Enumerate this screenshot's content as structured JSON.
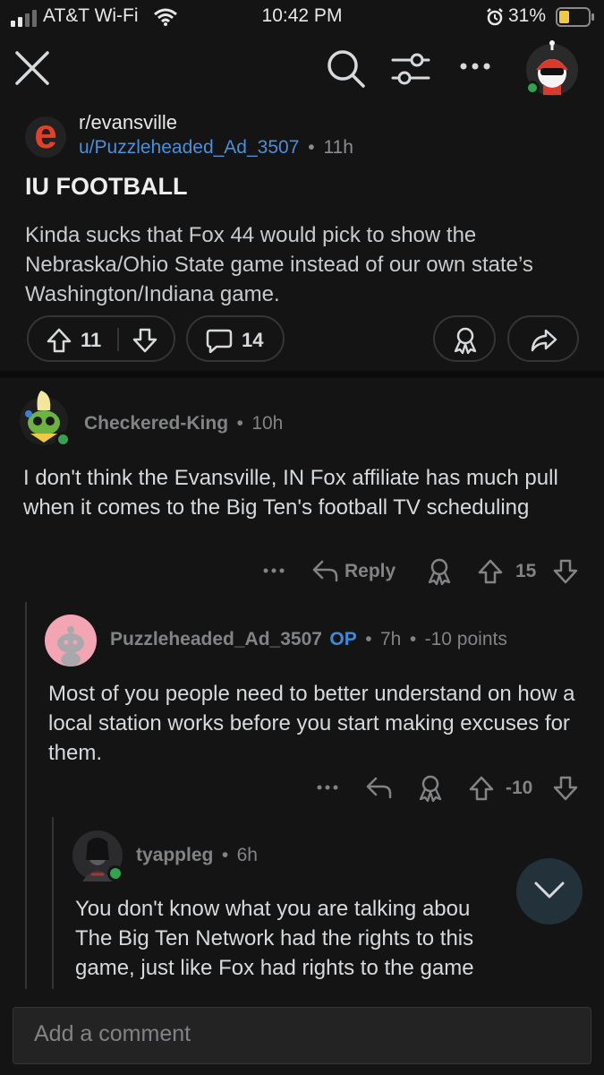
{
  "status_bar": {
    "carrier": "AT&T Wi-Fi",
    "time": "10:42 PM",
    "battery": "31%"
  },
  "nav": {
    "close_icon": "close-icon",
    "search_icon": "search-icon",
    "filter_icon": "sliders-icon",
    "more_icon": "more-icon"
  },
  "post": {
    "subreddit": "r/evansville",
    "author": "u/Puzzleheaded_Ad_3507",
    "separator": "•",
    "age": "11h",
    "title": "IU FOOTBALL",
    "body": "Kinda sucks that Fox 44 would pick to show the Nebraska/Ohio State game instead of our own state’s Washington/Indiana game.",
    "upvotes": "11",
    "comments": "14",
    "subreddit_icon_letter": "e",
    "colors": {
      "subreddit_icon_bg": "#222222",
      "subreddit_icon_fg": "#e0412a",
      "user_link": "#4a8fd9"
    }
  },
  "comments": [
    {
      "author": "Checkered-King",
      "separator": "•",
      "age": "10h",
      "body": "I don't think the Evansville, IN Fox affiliate has much pull when it comes to the Big Ten's football TV scheduling",
      "reply_label": "Reply",
      "score": "15"
    },
    {
      "author": "Puzzleheaded_Ad_3507",
      "op_badge": "OP",
      "separator": "•",
      "age": "7h",
      "points": "-10 points",
      "body": "Most of you people need to better understand on how a local station works before you start making excuses for them.",
      "score": "-10"
    },
    {
      "author": "tyappleg",
      "separator": "•",
      "age": "6h",
      "body_lines": [
        "You don't know what you are talking abou",
        "The Big Ten Network had the rights to this",
        "game, just like Fox had rights to the game"
      ]
    }
  ],
  "comment_bar": {
    "placeholder": "Add a comment"
  },
  "colors": {
    "online": "#2ea44f",
    "accent_op": "#3d8bd6",
    "background": "#141415"
  }
}
